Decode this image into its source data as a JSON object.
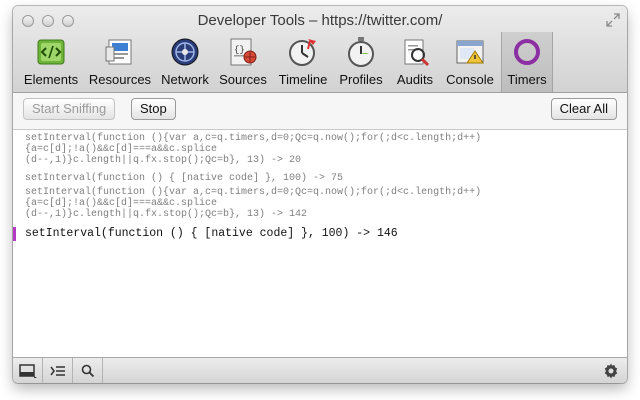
{
  "window": {
    "title": "Developer Tools – https://twitter.com/"
  },
  "toolbar": {
    "tools": [
      {
        "label": "Elements",
        "icon": "elements-icon"
      },
      {
        "label": "Resources",
        "icon": "resources-icon"
      },
      {
        "label": "Network",
        "icon": "network-icon"
      },
      {
        "label": "Sources",
        "icon": "sources-icon"
      },
      {
        "label": "Timeline",
        "icon": "timeline-icon"
      },
      {
        "label": "Profiles",
        "icon": "profiles-icon"
      },
      {
        "label": "Audits",
        "icon": "audits-icon"
      },
      {
        "label": "Console",
        "icon": "console-icon"
      },
      {
        "label": "Timers",
        "icon": "timers-icon",
        "selected": true
      }
    ]
  },
  "controls": {
    "start_label": "Start Sniffing",
    "stop_label": "Stop",
    "clear_label": "Clear All"
  },
  "log": {
    "entries": [
      {
        "lines": [
          "setInterval(function (){var a,c=q.timers,d=0;Qc=q.now();for(;d<c.length;d++)",
          "{a=c[d];!a()&&c[d]===a&&c.splice",
          "(d--,1)}c.length||q.fx.stop();Qc=b}, 13) -> 20"
        ]
      },
      {
        "lines": [
          "setInterval(function () { [native code] }, 100) -> 75"
        ]
      },
      {
        "lines": [
          "setInterval(function (){var a,c=q.timers,d=0;Qc=q.now();for(;d<c.length;d++)",
          "{a=c[d];!a()&&c[d]===a&&c.splice",
          "(d--,1)}c.length||q.fx.stop();Qc=b}, 13) -> 142"
        ]
      },
      {
        "lines": [
          "setInterval(function () { [native code] }, 100) -> 146"
        ],
        "active": true
      }
    ]
  },
  "colors": {
    "accent": "#b33bc4",
    "log_text": "#808080",
    "active_text": "#111111"
  }
}
